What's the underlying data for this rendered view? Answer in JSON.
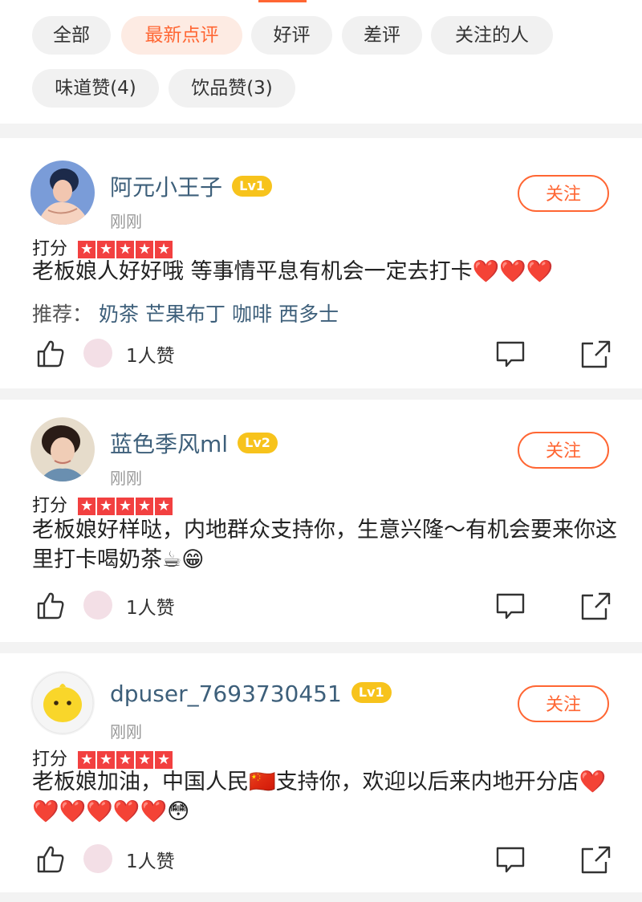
{
  "colors": {
    "accent": "#ff6633",
    "username": "#3d5f7a",
    "star": "#f24040",
    "level": "#f7c31c"
  },
  "filters": {
    "row1": [
      "全部",
      "最新点评",
      "好评",
      "差评",
      "关注的人"
    ],
    "row2": [
      "味道赞(4)",
      "饮品赞(3)"
    ],
    "active": "最新点评"
  },
  "reviews": [
    {
      "username": "阿元小王子",
      "level": "Lv1",
      "time": "刚刚",
      "follow": "关注",
      "rating_label": "打分",
      "stars": 5,
      "text": "老板娘人好好哦 等事情平息有机会一定去打卡❤️❤️❤️",
      "recommend_label": "推荐：",
      "recommend": [
        "奶茶",
        "芒果布丁",
        "咖啡",
        "西多士"
      ],
      "likes": "1人赞"
    },
    {
      "username": "蓝色季风ml",
      "level": "Lv2",
      "time": "刚刚",
      "follow": "关注",
      "rating_label": "打分",
      "stars": 5,
      "text": "老板娘好样哒，内地群众支持你，生意兴隆～有机会要来你这里打卡喝奶茶☕😁",
      "likes": "1人赞"
    },
    {
      "username": "dpuser_7693730451",
      "level": "Lv1",
      "time": "刚刚",
      "follow": "关注",
      "rating_label": "打分",
      "stars": 5,
      "text": "老板娘加油，中国人民🇨🇳支持你，欢迎以后来内地开分店❤️❤️❤️❤️❤️❤️😳",
      "likes": "1人赞"
    }
  ]
}
